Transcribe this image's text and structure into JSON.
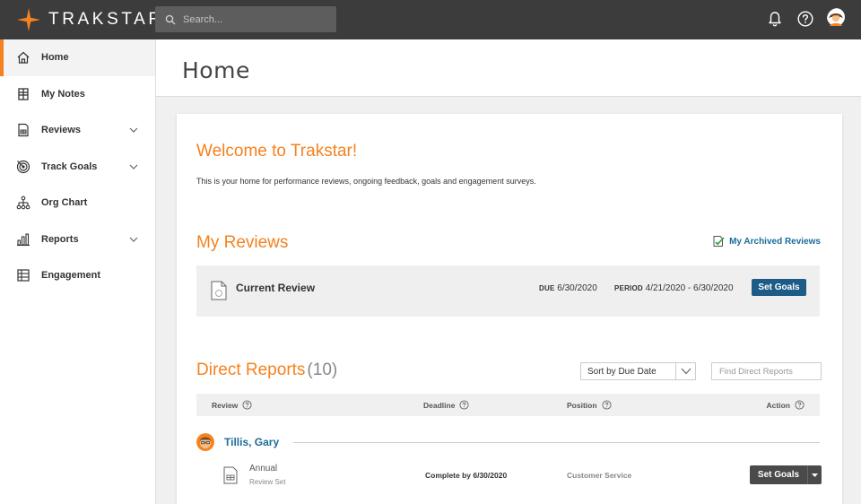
{
  "app": {
    "logo_text": "TRAKSTAR",
    "brand_color": "#f58220",
    "search_placeholder": "Search..."
  },
  "topbar_icons": [
    "bell-icon",
    "help-icon",
    "user-avatar"
  ],
  "sidebar": {
    "items": [
      {
        "label": "Home",
        "icon": "home-icon",
        "active": true,
        "expandable": false
      },
      {
        "label": "My Notes",
        "icon": "notes-icon",
        "active": false,
        "expandable": false
      },
      {
        "label": "Reviews",
        "icon": "reviews-icon",
        "active": false,
        "expandable": true
      },
      {
        "label": "Track Goals",
        "icon": "target-icon",
        "active": false,
        "expandable": true
      },
      {
        "label": "Org Chart",
        "icon": "org-chart-icon",
        "active": false,
        "expandable": false
      },
      {
        "label": "Reports",
        "icon": "bar-chart-icon",
        "active": false,
        "expandable": true
      },
      {
        "label": "Engagement",
        "icon": "engagement-icon",
        "active": false,
        "expandable": false
      }
    ]
  },
  "header": {
    "title": "Home"
  },
  "welcome": {
    "title": "Welcome to Trakstar!",
    "text": "This is your home for performance reviews, ongoing feedback, goals and engagement surveys."
  },
  "my_reviews": {
    "title": "My Reviews",
    "archived_link": "My Archived Reviews",
    "current": {
      "title": "Current Review",
      "due_label": "DUE",
      "due": "6/30/2020",
      "period_label": "PERIOD",
      "period": "4/21/2020 - 6/30/2020",
      "button": "Set Goals"
    }
  },
  "direct_reports": {
    "title": "Direct Reports",
    "count": "(10)",
    "sort_value": "Sort by Due Date",
    "find_placeholder": "Find Direct Reports",
    "columns": [
      "Review",
      "Deadline",
      "Position",
      "Action"
    ],
    "people": [
      {
        "name": "Tillis, Gary",
        "review_name": "Annual",
        "review_sub": "Review Set",
        "deadline": "Complete by 6/30/2020",
        "position": "Customer Service",
        "action": "Set Goals"
      }
    ]
  },
  "colors": {
    "topbar": "#3c3c3c",
    "accent": "#f58220",
    "link": "#1b6d9a",
    "primary_button": "#1c5c87",
    "dark_button": "#4a4a4a"
  }
}
